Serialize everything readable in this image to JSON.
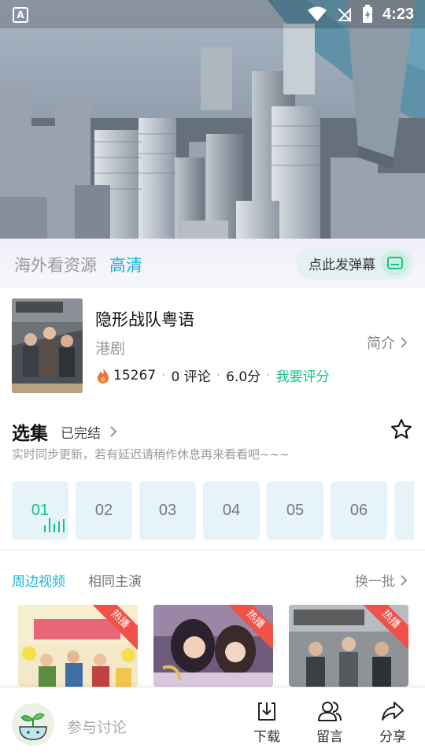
{
  "status_bar": {
    "app_badge": "A",
    "time": "4:23"
  },
  "player": {
    "source_label": "海外看资源",
    "quality_label": "高清",
    "danmaku_button": "点此发弹幕"
  },
  "show": {
    "title": "隐形战队粤语",
    "genre": "港剧",
    "intro_label": "简介",
    "heat": "15267",
    "comments": "0 评论",
    "score": "6.0分",
    "rate_label": "我要评分",
    "dot": "·"
  },
  "episodes": {
    "title": "选集",
    "status": "已完结",
    "note": "实时同步更新，若有延迟请稍作休息再来看看吧~~~",
    "items": [
      "01",
      "02",
      "03",
      "04",
      "05",
      "06"
    ],
    "current": "01"
  },
  "related": {
    "tabs": [
      "周边视频",
      "相同主演"
    ],
    "swap_label": "换一批",
    "cards": [
      {
        "badge": "热播"
      },
      {
        "badge": "热播"
      },
      {
        "badge": "热播"
      }
    ]
  },
  "bottom_bar": {
    "discuss_placeholder": "参与讨论",
    "actions": [
      "下载",
      "留言",
      "分享"
    ]
  },
  "colors": {
    "accent_teal": "#19b4d8",
    "accent_green": "#14c28a",
    "hot_red": "#f0524a"
  }
}
